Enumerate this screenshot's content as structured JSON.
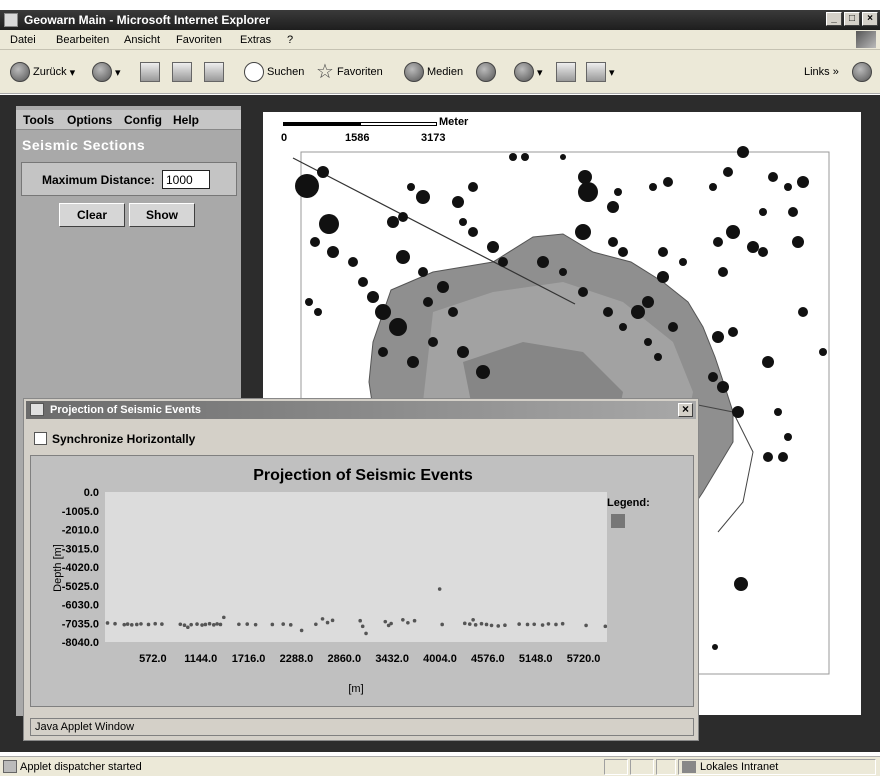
{
  "window": {
    "title": "Geowarn Main - Microsoft Internet Explorer",
    "controls": [
      "_",
      "□",
      "×"
    ]
  },
  "menu": [
    "Datei",
    "Bearbeiten",
    "Ansicht",
    "Favoriten",
    "Extras",
    "?"
  ],
  "toolbar": {
    "back": "Zurück",
    "search": "Suchen",
    "favorites": "Favoriten",
    "media": "Medien",
    "links": "Links",
    "chevron": "»"
  },
  "applet": {
    "menu": [
      "Tools",
      "Options",
      "Config",
      "Help"
    ],
    "section_title": "Seismic Sections",
    "max_distance_label": "Maximum Distance:",
    "max_distance_value": "1000",
    "clear_button": "Clear",
    "show_button": "Show"
  },
  "map": {
    "scale_unit": "Meter",
    "scale_labels": [
      "0",
      "1586",
      "3173"
    ]
  },
  "dialog": {
    "title": "Projection of Seismic Events",
    "close": "×",
    "sync_label": "Synchronize Horizontally",
    "applet_status": "Java Applet Window"
  },
  "chart_data": {
    "type": "scatter",
    "title": "Projection of Seismic Events",
    "xlabel": "[m]",
    "ylabel": "Depth [m]",
    "legend_title": "Legend:",
    "legend_color": "#777777",
    "marker_color": "#555555",
    "xlim": [
      0,
      6000
    ],
    "ylim": [
      -8040,
      0
    ],
    "x_ticks": [
      "572.0",
      "1144.0",
      "1716.0",
      "2288.0",
      "2860.0",
      "3432.0",
      "4004.0",
      "4576.0",
      "5148.0",
      "5720.0"
    ],
    "x_tick_values": [
      572,
      1144,
      1716,
      2288,
      2860,
      3432,
      4004,
      4576,
      5148,
      5720
    ],
    "y_ticks": [
      "0.0",
      "-1005.0",
      "-2010.0",
      "-3015.0",
      "-4020.0",
      "-5025.0",
      "-6030.0",
      "-7035.0",
      "-8040.0"
    ],
    "y_tick_values": [
      0,
      -1005,
      -2010,
      -3015,
      -4020,
      -5025,
      -6030,
      -7035,
      -8040
    ],
    "points": [
      [
        30,
        -7020
      ],
      [
        120,
        -7060
      ],
      [
        230,
        -7110
      ],
      [
        270,
        -7080
      ],
      [
        320,
        -7120
      ],
      [
        380,
        -7100
      ],
      [
        430,
        -7070
      ],
      [
        520,
        -7100
      ],
      [
        600,
        -7060
      ],
      [
        680,
        -7080
      ],
      [
        900,
        -7090
      ],
      [
        950,
        -7140
      ],
      [
        990,
        -7250
      ],
      [
        1030,
        -7110
      ],
      [
        1100,
        -7080
      ],
      [
        1160,
        -7130
      ],
      [
        1200,
        -7100
      ],
      [
        1250,
        -7060
      ],
      [
        1300,
        -7120
      ],
      [
        1340,
        -7070
      ],
      [
        1380,
        -7100
      ],
      [
        1420,
        -6720
      ],
      [
        1600,
        -7090
      ],
      [
        1700,
        -7080
      ],
      [
        1800,
        -7110
      ],
      [
        2000,
        -7100
      ],
      [
        2130,
        -7080
      ],
      [
        2220,
        -7120
      ],
      [
        2350,
        -7420
      ],
      [
        2520,
        -7090
      ],
      [
        2600,
        -6800
      ],
      [
        2660,
        -7000
      ],
      [
        2720,
        -6880
      ],
      [
        3050,
        -6900
      ],
      [
        3080,
        -7200
      ],
      [
        3120,
        -7580
      ],
      [
        3350,
        -6950
      ],
      [
        3390,
        -7150
      ],
      [
        3420,
        -7050
      ],
      [
        3560,
        -6850
      ],
      [
        3620,
        -7010
      ],
      [
        3700,
        -6900
      ],
      [
        4000,
        -5200
      ],
      [
        4030,
        -7100
      ],
      [
        4300,
        -7040
      ],
      [
        4360,
        -7080
      ],
      [
        4400,
        -6850
      ],
      [
        4430,
        -7120
      ],
      [
        4500,
        -7060
      ],
      [
        4560,
        -7100
      ],
      [
        4620,
        -7150
      ],
      [
        4700,
        -7180
      ],
      [
        4780,
        -7140
      ],
      [
        4950,
        -7080
      ],
      [
        5050,
        -7100
      ],
      [
        5130,
        -7090
      ],
      [
        5230,
        -7130
      ],
      [
        5300,
        -7070
      ],
      [
        5390,
        -7100
      ],
      [
        5470,
        -7060
      ],
      [
        5750,
        -7150
      ],
      [
        5980,
        -7200
      ]
    ]
  }
}
